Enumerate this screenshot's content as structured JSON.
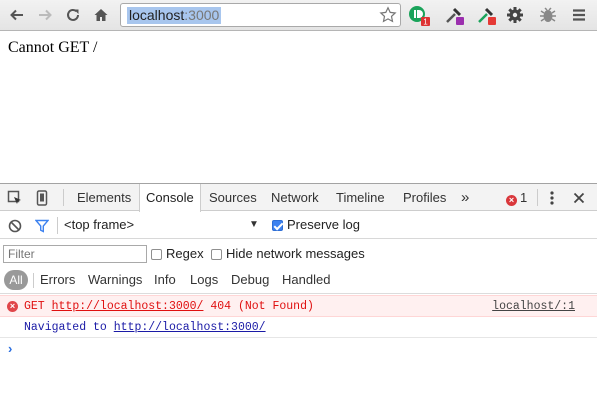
{
  "browser": {
    "url_host": "localhost",
    "url_port": ":3000",
    "icons": {
      "back": "back-arrow-icon",
      "forward": "forward-arrow-icon",
      "reload": "reload-icon",
      "home": "home-icon",
      "bookmark": "star-icon",
      "extensions": [
        "green-extension-icon",
        "eyedropper-purple-icon",
        "eyedropper-red-icon",
        "gear-icon",
        "bug-icon"
      ],
      "menu": "hamburger-menu-icon"
    },
    "extension_badge": "1"
  },
  "page": {
    "message": "Cannot GET /"
  },
  "devtools": {
    "tabs": [
      "Elements",
      "Console",
      "Sources",
      "Network",
      "Timeline",
      "Profiles"
    ],
    "active_tab": "Console",
    "more_tabs": "»",
    "error_count": "1",
    "frame_select": "<top frame>",
    "preserve_log_label": "Preserve log",
    "preserve_log_checked": true,
    "filter_placeholder": "Filter",
    "regex_label": "Regex",
    "hide_network_label": "Hide network messages",
    "levels": [
      "All",
      "Errors",
      "Warnings",
      "Info",
      "Logs",
      "Debug",
      "Handled"
    ],
    "messages": {
      "error": {
        "method": "GET",
        "url": "http://localhost:3000/",
        "status": "404 (Not Found)",
        "source": "localhost/:1"
      },
      "navigated": {
        "prefix": "Navigated to",
        "url": "http://localhost:3000/"
      }
    },
    "prompt": "›",
    "colors": {
      "error_text": "#e01010",
      "error_bg": "#fff0f0",
      "nav_text": "#1a1aa6",
      "accent": "#3d82f0"
    }
  }
}
